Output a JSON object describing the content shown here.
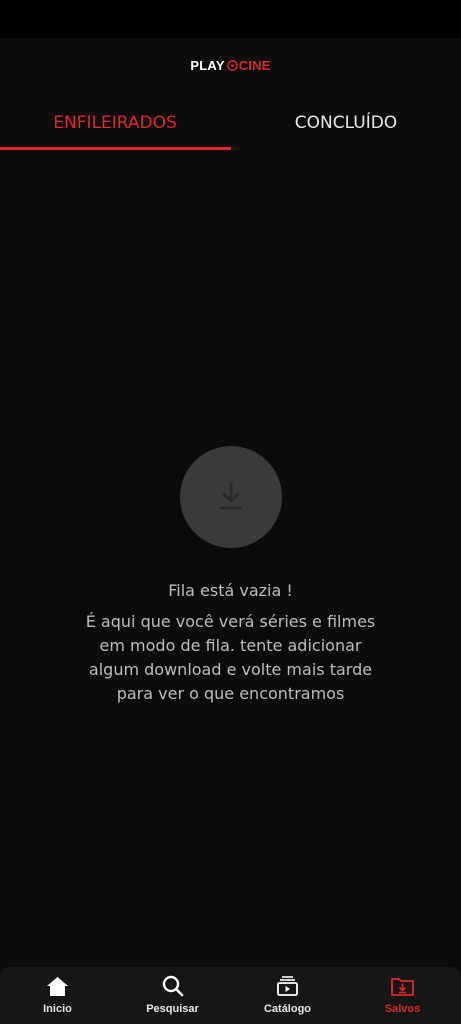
{
  "app": {
    "logo_left": "PLAY",
    "logo_right": "CINE",
    "brand_color": "#e0262a"
  },
  "tabs": [
    {
      "label": "ENFILEIRADOS",
      "active": true
    },
    {
      "label": "CONCLUÍDO",
      "active": false
    }
  ],
  "empty_state": {
    "icon": "download-icon",
    "title": "Fila está vazia !",
    "message": "É aqui que você verá séries e filmes em modo de fila. tente adicionar algum download e volte mais tarde para ver o que encontramos"
  },
  "bottom_nav": [
    {
      "label": "Inicio",
      "icon": "home-icon",
      "active": false
    },
    {
      "label": "Pesquisar",
      "icon": "search-icon",
      "active": false
    },
    {
      "label": "Catálogo",
      "icon": "catalog-icon",
      "active": false
    },
    {
      "label": "Salvos",
      "icon": "saved-folder-icon",
      "active": true
    }
  ]
}
